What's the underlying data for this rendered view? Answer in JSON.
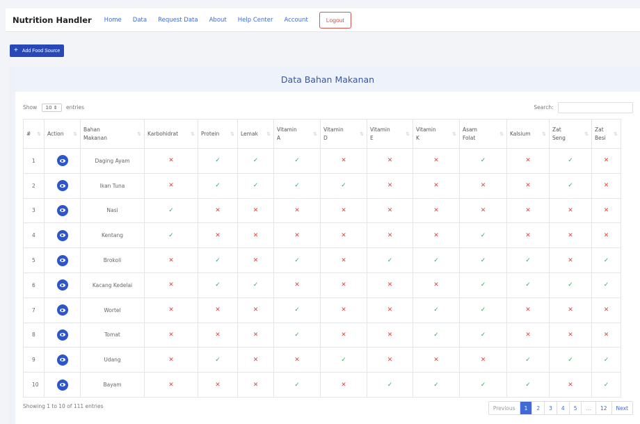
{
  "navbar": {
    "brand": "Nutrition Handler",
    "links": [
      "Home",
      "Data",
      "Request Data",
      "About",
      "Help Center",
      "Account"
    ],
    "logout": "Logout"
  },
  "add_button": {
    "label": "Add Food Source"
  },
  "card": {
    "title": "Data Bahan Makanan"
  },
  "controls": {
    "show": "Show",
    "entries_value": "10",
    "entries": "entries",
    "search_label": "Search:"
  },
  "table": {
    "headers": [
      [
        "#"
      ],
      [
        "Action"
      ],
      [
        "Bahan",
        "Makanan"
      ],
      [
        "Karbohidrat"
      ],
      [
        "Protein"
      ],
      [
        "Lemak"
      ],
      [
        "Vitamin",
        "A"
      ],
      [
        "Vitamin",
        "D"
      ],
      [
        "Vitamin",
        "E"
      ],
      [
        "Vitamin",
        "K"
      ],
      [
        "Asam",
        "Folat"
      ],
      [
        "Kalsium"
      ],
      [
        "Zat",
        "Seng"
      ],
      [
        "Zat",
        "Besi"
      ]
    ],
    "rows": [
      {
        "n": "1",
        "name": "Daging Ayam",
        "v": [
          0,
          1,
          1,
          1,
          0,
          0,
          0,
          1,
          0,
          1,
          0
        ]
      },
      {
        "n": "2",
        "name": "Ikan Tuna",
        "v": [
          0,
          1,
          1,
          1,
          1,
          0,
          0,
          0,
          0,
          1,
          0
        ]
      },
      {
        "n": "3",
        "name": "Nasi",
        "v": [
          1,
          0,
          0,
          0,
          0,
          0,
          0,
          0,
          0,
          0,
          0
        ]
      },
      {
        "n": "4",
        "name": "Kentang",
        "v": [
          1,
          0,
          0,
          0,
          0,
          0,
          0,
          1,
          0,
          0,
          0
        ]
      },
      {
        "n": "5",
        "name": "Brokoli",
        "v": [
          0,
          1,
          0,
          1,
          0,
          1,
          1,
          1,
          1,
          0,
          1
        ]
      },
      {
        "n": "6",
        "name": "Kacang Kedelai",
        "v": [
          0,
          1,
          1,
          0,
          0,
          0,
          0,
          1,
          1,
          1,
          1
        ]
      },
      {
        "n": "7",
        "name": "Wortel",
        "v": [
          0,
          0,
          0,
          1,
          0,
          0,
          1,
          1,
          0,
          0,
          0
        ]
      },
      {
        "n": "8",
        "name": "Tomat",
        "v": [
          0,
          0,
          0,
          1,
          0,
          0,
          1,
          1,
          0,
          0,
          0
        ]
      },
      {
        "n": "9",
        "name": "Udang",
        "v": [
          0,
          1,
          0,
          0,
          1,
          0,
          0,
          0,
          1,
          1,
          1
        ]
      },
      {
        "n": "10",
        "name": "Bayam",
        "v": [
          0,
          0,
          0,
          1,
          0,
          1,
          1,
          1,
          1,
          0,
          1
        ]
      }
    ]
  },
  "footer": {
    "info": "Showing 1 to 10 of 111 entries"
  },
  "pagination": {
    "items": [
      "Previous",
      "1",
      "2",
      "3",
      "4",
      "5",
      "…",
      "12",
      "Next"
    ],
    "active": "1"
  }
}
